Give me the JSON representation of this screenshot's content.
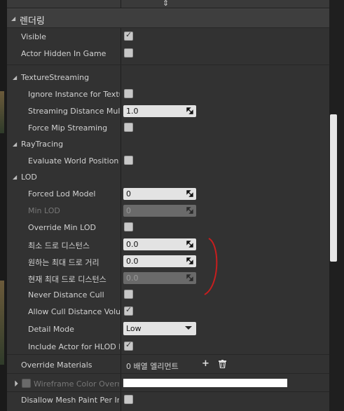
{
  "section": {
    "title": "렌더링"
  },
  "rendering": {
    "visible": {
      "label": "Visible",
      "checked": true
    },
    "actor_hidden": {
      "label": "Actor Hidden In Game",
      "checked": false
    }
  },
  "texture_streaming": {
    "title": "TextureStreaming",
    "ignore_instance": {
      "label": "Ignore Instance for Texture",
      "checked": false
    },
    "streaming_distance": {
      "label": "Streaming Distance Multip",
      "value": "1.0"
    },
    "force_mip": {
      "label": "Force Mip Streaming",
      "checked": false
    }
  },
  "ray_tracing": {
    "title": "RayTracing",
    "evaluate_wpo": {
      "label": "Evaluate World Position Of",
      "checked": false
    }
  },
  "lod": {
    "title": "LOD",
    "forced_lod": {
      "label": "Forced Lod Model",
      "value": "0"
    },
    "min_lod": {
      "label": "Min LOD",
      "value": "0"
    },
    "override_min_lod": {
      "label": "Override Min LOD",
      "checked": false
    },
    "min_draw_distance": {
      "label": "최소 드로 디스턴스",
      "value": "0.0"
    },
    "desired_max_draw": {
      "label": "원하는 최대 드로 거리",
      "value": "0.0"
    },
    "current_max_draw": {
      "label": "현재 최대 드로 디스턴스",
      "value": "0.0"
    },
    "never_distance_cull": {
      "label": "Never Distance Cull",
      "checked": false
    },
    "allow_cull_volume": {
      "label": "Allow Cull Distance Volume",
      "checked": true
    },
    "detail_mode": {
      "label": "Detail Mode",
      "value": "Low"
    },
    "include_hlod": {
      "label": "Include Actor for HLOD Me",
      "checked": true
    }
  },
  "override_materials": {
    "label": "Override Materials",
    "value": "0 배열 엘리먼트"
  },
  "wireframe_color": {
    "label": "Wireframe Color Override",
    "color": "#ffffff"
  },
  "disallow_mesh_paint": {
    "label": "Disallow Mesh Paint Per Inst",
    "checked": false
  },
  "colors": {
    "annotation": "#c81e1e",
    "panel": "#323232",
    "field": "#e3e3e3"
  }
}
